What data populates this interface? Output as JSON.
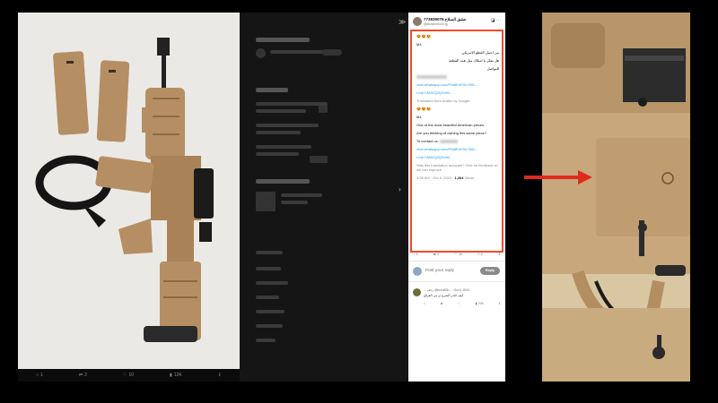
{
  "left_panel": {
    "action_bar": {
      "replies": "1",
      "reposts": "2",
      "likes": "10",
      "views": "12K"
    }
  },
  "tweet": {
    "display_name": "عشق السلاح 773839076",
    "handle": "@alrashed449.ig",
    "emoji_top": "😍😍😍",
    "model_ar": "M4",
    "line1_ar": "من اجمل القطع الامريكي",
    "line2_ar": "هل تفكر با امتلاك مثل هذه القطعة",
    "contact_ar": "للتواصل",
    "chat_link_1": "chat.whatsapp.com/FNdfKnK5uY6iD...",
    "tme_link_1": "t.me/+ANVQ2QSHM...",
    "translated_from": "Translated from Arabic by Google",
    "emoji_mid": "😍😍😍",
    "model_en": "M4",
    "line1_en": "One of the most beautiful American pieces",
    "line2_en": "Are you thinking of owning this same piece?",
    "contact_en": "To contact us:",
    "chat_link_2": "chat.whatsapp.com/FNdfKnK5uY6iD...",
    "tme_link_2": "t.me/+ANVQ2QSHM...",
    "feedback": "Was this translation accurate? Give us feedback so we can improve",
    "timestamp": "3:09 AM · Oct 6, 2024 · ",
    "views": "1,264",
    "views_label": "Views",
    "stats": {
      "replies": "1",
      "reposts": "2",
      "likes": "10",
      "bookmarks": "2"
    },
    "reply_placeholder": "Post your reply",
    "reply_button": "Reply",
    "comment": {
      "meta": "... رجف @mmdf38... · Oct 6, 2024",
      "text": "كيف اقدر الشرع ي من العراق",
      "stats": {
        "replies": "",
        "reposts": "",
        "likes": "",
        "views": "299"
      }
    }
  },
  "colors": {
    "highlight": "#f14b2a",
    "link": "#1d9bf0",
    "rifle_tan": "#b58f63"
  }
}
